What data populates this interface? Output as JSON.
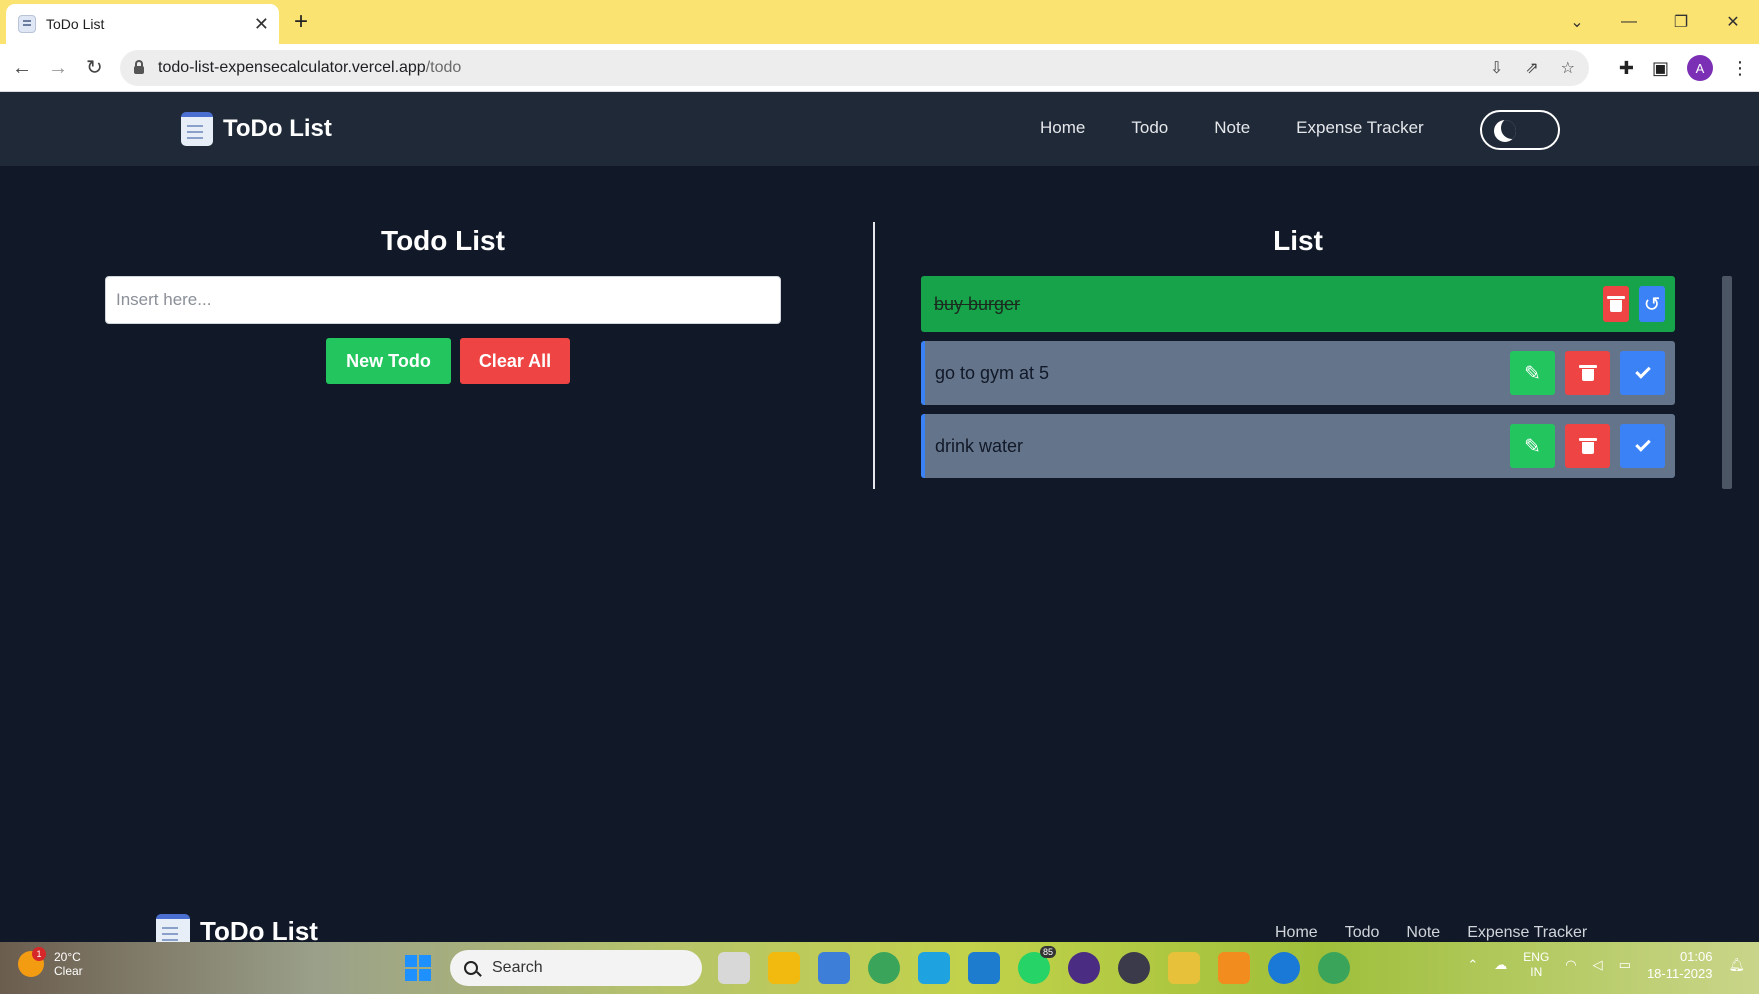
{
  "browser": {
    "tab_title": "ToDo List",
    "tab_close": "✕",
    "new_tab": "+",
    "window_controls": {
      "dropdown": "⌄",
      "minimize": "—",
      "restore": "❐",
      "close": "✕"
    },
    "nav": {
      "back": "←",
      "forward": "→",
      "reload": "↻"
    },
    "url_host": "todo-list-expensecalculator.vercel.app",
    "url_path": "/todo",
    "omnibox_icons": [
      "install-icon",
      "share-icon",
      "star-icon"
    ],
    "extension_icons": [
      "puzzle-icon",
      "sidepanel-icon"
    ],
    "profile_initial": "A"
  },
  "navbar": {
    "brand": "ToDo List",
    "links": [
      "Home",
      "Todo",
      "Note",
      "Expense Tracker"
    ],
    "theme_toggle_icon": "moon-icon"
  },
  "todo_panel": {
    "title": "Todo List",
    "input_placeholder": "Insert here...",
    "new_button": "New Todo",
    "clear_button": "Clear All"
  },
  "list_panel": {
    "title": "List",
    "items": [
      {
        "text": "buy burger",
        "completed": true,
        "actions": [
          "delete-icon",
          "undo-icon"
        ]
      },
      {
        "text": "go to gym at 5",
        "completed": false,
        "actions": [
          "edit-icon",
          "delete-icon",
          "check-icon"
        ]
      },
      {
        "text": "drink water",
        "completed": false,
        "actions": [
          "edit-icon",
          "delete-icon",
          "check-icon"
        ]
      }
    ]
  },
  "footer": {
    "brand": "ToDo List",
    "links": [
      "Home",
      "Todo",
      "Note",
      "Expense Tracker"
    ]
  },
  "taskbar": {
    "weather_temp": "20°C",
    "weather_desc": "Clear",
    "weather_badge": "1",
    "search_label": "Search",
    "whatsapp_badge": "85",
    "lang_top": "ENG",
    "lang_bottom": "IN",
    "time": "01:06",
    "date": "18-11-2023"
  },
  "colors": {
    "page_bg": "#111827",
    "navbar_bg": "#1f2937",
    "success": "#22c55e",
    "danger": "#ef4444",
    "primary": "#3b82f6",
    "done_item": "#16a34a",
    "pending_item": "#64748b"
  }
}
